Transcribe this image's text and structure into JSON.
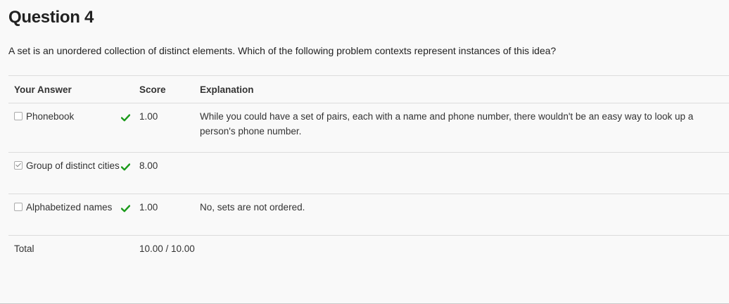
{
  "question": {
    "title": "Question 4",
    "text": "A set is an unordered collection of distinct elements. Which of the following problem contexts represent instances of this idea?"
  },
  "table": {
    "headers": {
      "answer": "Your Answer",
      "score": "Score",
      "explanation": "Explanation"
    },
    "rows": [
      {
        "answer": "Phonebook",
        "checked": false,
        "correct_icon": "check-icon",
        "score": "1.00",
        "explanation": "While you could have a set of pairs, each with a name and phone number, there wouldn't be an easy way to look up a person's phone number."
      },
      {
        "answer": "Group of distinct cities",
        "checked": true,
        "correct_icon": "check-icon",
        "score": "8.00",
        "explanation": ""
      },
      {
        "answer": "Alphabetized names",
        "checked": false,
        "correct_icon": "check-icon",
        "score": "1.00",
        "explanation": "No, sets are not ordered."
      }
    ],
    "total": {
      "label": "Total",
      "score": "10.00 / 10.00"
    }
  },
  "colors": {
    "check_green": "#1a9a1a",
    "background": "#f9f9f9",
    "border": "#dcdcdc"
  }
}
